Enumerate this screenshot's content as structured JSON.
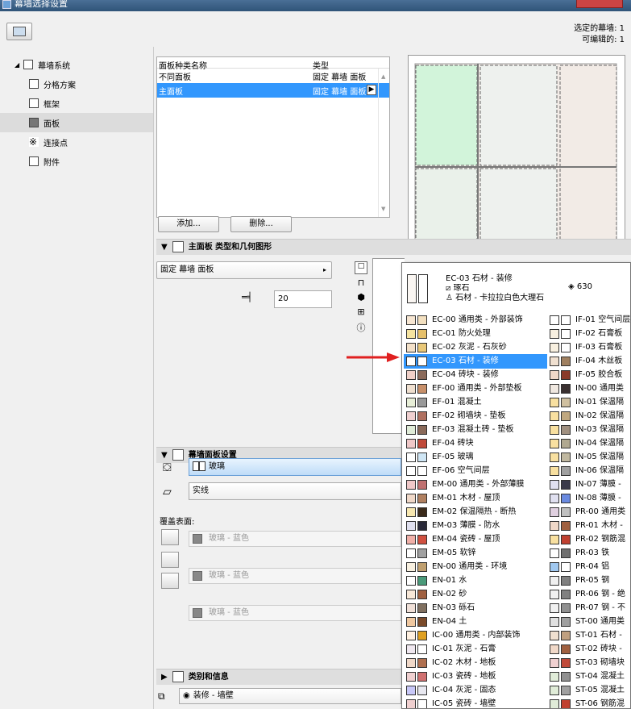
{
  "window": {
    "title": "幕墙选择设置"
  },
  "header": {
    "selected": "选定的幕墙: 1",
    "editable": "可编辑的: 1"
  },
  "tree": {
    "root": "幕墙系统",
    "items": [
      {
        "label": "分格方案"
      },
      {
        "label": "框架"
      },
      {
        "label": "面板"
      },
      {
        "label": "连接点"
      },
      {
        "label": "附件"
      }
    ]
  },
  "panel_list": {
    "col_name": "面板种类名称",
    "col_type": "类型",
    "rows": [
      {
        "name": "不同面板",
        "type": "固定 幕墙 面板"
      },
      {
        "name": "主面板",
        "type": "固定 幕墙 面板"
      }
    ],
    "add": "添加...",
    "delete": "删除..."
  },
  "section_geom": {
    "title": "主面板 类型和几何图形",
    "type_value": "固定 幕墙 面板",
    "thickness": "20"
  },
  "section_settings": {
    "title": "幕墙面板设置",
    "material": "玻璃",
    "line": "实线",
    "cover_label": "覆盖表面:",
    "covers": [
      "玻璃 - 蓝色",
      "玻璃 - 蓝色",
      "玻璃 - 蓝色"
    ]
  },
  "section_class": {
    "title": "类别和信息"
  },
  "bottom": {
    "layer": "装修 - 墙壁"
  },
  "popup": {
    "header": {
      "code": "EC-03 石材 - 装修",
      "hatch": "琢石",
      "material": "石材 - 卡拉拉白色大理石",
      "num": "630"
    },
    "left": [
      {
        "t": "EC-00 通用类 - 外部装饰",
        "c1": "#f7e6d2",
        "c2": "#f3e0c0"
      },
      {
        "t": "EC-01 防火处理",
        "c1": "#f5e3a0",
        "c2": "#e6c06a"
      },
      {
        "t": "EC-02 灰泥 - 石灰砂",
        "c1": "#f3e0c8",
        "c2": "#e9c878"
      },
      {
        "t": "EC-03 石材 - 装修",
        "c1": "#ffffff",
        "c2": "#ffffff"
      },
      {
        "t": "EC-04 砖块 - 装修",
        "c1": "#f0d0c8",
        "c2": "#8b6a5a"
      },
      {
        "t": "EF-00 通用类 - 外部垫板",
        "c1": "#f0e0d0",
        "c2": "#c8906a"
      },
      {
        "t": "EF-01 混凝土",
        "c1": "#e8efd8",
        "c2": "#9a9a9a"
      },
      {
        "t": "EF-02 砌墙块 - 垫板",
        "c1": "#f0d0d0",
        "c2": "#b07060"
      },
      {
        "t": "EF-03 混凝土砖 - 垫板",
        "c1": "#e0ecd8",
        "c2": "#8a6a5a"
      },
      {
        "t": "EF-04 砖块",
        "c1": "#f0c8c8",
        "c2": "#c04a3a"
      },
      {
        "t": "EF-05 玻璃",
        "c1": "#ffffff",
        "c2": "#cfe6f5"
      },
      {
        "t": "EF-06 空气间层",
        "c1": "#ffffff",
        "c2": "#ffffff"
      },
      {
        "t": "EM-00 通用类 - 外部薄膜",
        "c1": "#f0c8c8",
        "c2": "#c07070"
      },
      {
        "t": "EM-01 木材 - 屋顶",
        "c1": "#f0d8c8",
        "c2": "#b08060"
      },
      {
        "t": "EM-02 保温隔热 - 断热",
        "c1": "#f8e8b0",
        "c2": "#3a2a1a"
      },
      {
        "t": "EM-03 薄膜 - 防水",
        "c1": "#e0e0ef",
        "c2": "#2a2a3a"
      },
      {
        "t": "EM-04 瓷砖 - 屋顶",
        "c1": "#f0b0a8",
        "c2": "#d05040"
      },
      {
        "t": "EM-05 软锌",
        "c1": "#ffffff",
        "c2": "#a0a0a0"
      },
      {
        "t": "EN-00 通用类 - 环境",
        "c1": "#f8f0e0",
        "c2": "#c0a070"
      },
      {
        "t": "EN-01 水",
        "c1": "#ffffff",
        "c2": "#4a9a7a"
      },
      {
        "t": "EN-02 砂",
        "c1": "#f8e8d8",
        "c2": "#a06040"
      },
      {
        "t": "EN-03 砾石",
        "c1": "#f0e0d8",
        "c2": "#807060"
      },
      {
        "t": "EN-04 土",
        "c1": "#f0c8a0",
        "c2": "#7a4a2a"
      },
      {
        "t": "IC-00 通用类 - 内部装饰",
        "c1": "#fff0e0",
        "c2": "#e0a020"
      },
      {
        "t": "IC-01 灰泥 - 石膏",
        "c1": "#f0e8f0",
        "c2": "#ffffff"
      },
      {
        "t": "IC-02 木材 - 地板",
        "c1": "#f0d8c8",
        "c2": "#b07050"
      },
      {
        "t": "IC-03 瓷砖 - 地板",
        "c1": "#f0d0d0",
        "c2": "#d07070"
      },
      {
        "t": "IC-04 灰泥 - 固态",
        "c1": "#c8c8f8",
        "c2": "#e8e8f0"
      },
      {
        "t": "IC-05 瓷砖 - 墙壁",
        "c1": "#f0d0d0",
        "c2": "#ffffff"
      }
    ],
    "right": [
      {
        "t": "IF-01 空气间层",
        "c1": "#ffffff",
        "c2": "#ffffff"
      },
      {
        "t": "IF-02 石膏板",
        "c1": "#f8f0e0",
        "c2": "#ffffff"
      },
      {
        "t": "IF-03 石膏板",
        "c1": "#f8f0e0",
        "c2": "#ffffff"
      },
      {
        "t": "IF-04 木丝板",
        "c1": "#f0e0d0",
        "c2": "#a08060"
      },
      {
        "t": "IF-05 胶合板",
        "c1": "#f0d8c8",
        "c2": "#8a3a2a"
      },
      {
        "t": "IN-00 通用类",
        "c1": "#f0e8e0",
        "c2": "#3a3030"
      },
      {
        "t": "IN-01 保温隔",
        "c1": "#f8e0a0",
        "c2": "#d0c0a0"
      },
      {
        "t": "IN-02 保温隔",
        "c1": "#f8e0a0",
        "c2": "#c0a880"
      },
      {
        "t": "IN-03 保温隔",
        "c1": "#f8e0a0",
        "c2": "#a09080"
      },
      {
        "t": "IN-04 保温隔",
        "c1": "#f8e0a0",
        "c2": "#b0a890"
      },
      {
        "t": "IN-05 保温隔",
        "c1": "#f8e0a0",
        "c2": "#c0b8a0"
      },
      {
        "t": "IN-06 保温隔",
        "c1": "#f8e0a0",
        "c2": "#a0a0a0"
      },
      {
        "t": "IN-07 薄膜 -",
        "c1": "#e0e0f0",
        "c2": "#3a3a4a"
      },
      {
        "t": "IN-08 薄膜 -",
        "c1": "#e0e0f0",
        "c2": "#6a8ae0"
      },
      {
        "t": "PR-00 通用类",
        "c1": "#e0d0e0",
        "c2": "#c0c0c0"
      },
      {
        "t": "PR-01 木材 -",
        "c1": "#f0d8c8",
        "c2": "#a06040"
      },
      {
        "t": "PR-02 钢筋混",
        "c1": "#f8e0a0",
        "c2": "#c04030"
      },
      {
        "t": "PR-03 铁",
        "c1": "#ffffff",
        "c2": "#707070"
      },
      {
        "t": "PR-04 铝",
        "c1": "#a0c8f0",
        "c2": "#ffffff"
      },
      {
        "t": "PR-05 钢",
        "c1": "#f0f0f0",
        "c2": "#808080"
      },
      {
        "t": "PR-06 钢 - 绝",
        "c1": "#f0f0f0",
        "c2": "#808080"
      },
      {
        "t": "PR-07 钢 - 不",
        "c1": "#f0f0f0",
        "c2": "#909090"
      },
      {
        "t": "ST-00 通用类",
        "c1": "#e0e0e0",
        "c2": "#a0a0a0"
      },
      {
        "t": "ST-01 石材 -",
        "c1": "#f0e0d0",
        "c2": "#c0a080"
      },
      {
        "t": "ST-02 砖块 -",
        "c1": "#f0d8c8",
        "c2": "#a06040"
      },
      {
        "t": "ST-03 砌墙块",
        "c1": "#f0d0d0",
        "c2": "#c04a3a"
      },
      {
        "t": "ST-04 混凝土",
        "c1": "#e0ecd8",
        "c2": "#909090"
      },
      {
        "t": "ST-05 混凝土",
        "c1": "#e0ecd8",
        "c2": "#a0a0a0"
      },
      {
        "t": "ST-06 钢筋混",
        "c1": "#e0ecd8",
        "c2": "#c04030"
      }
    ]
  }
}
